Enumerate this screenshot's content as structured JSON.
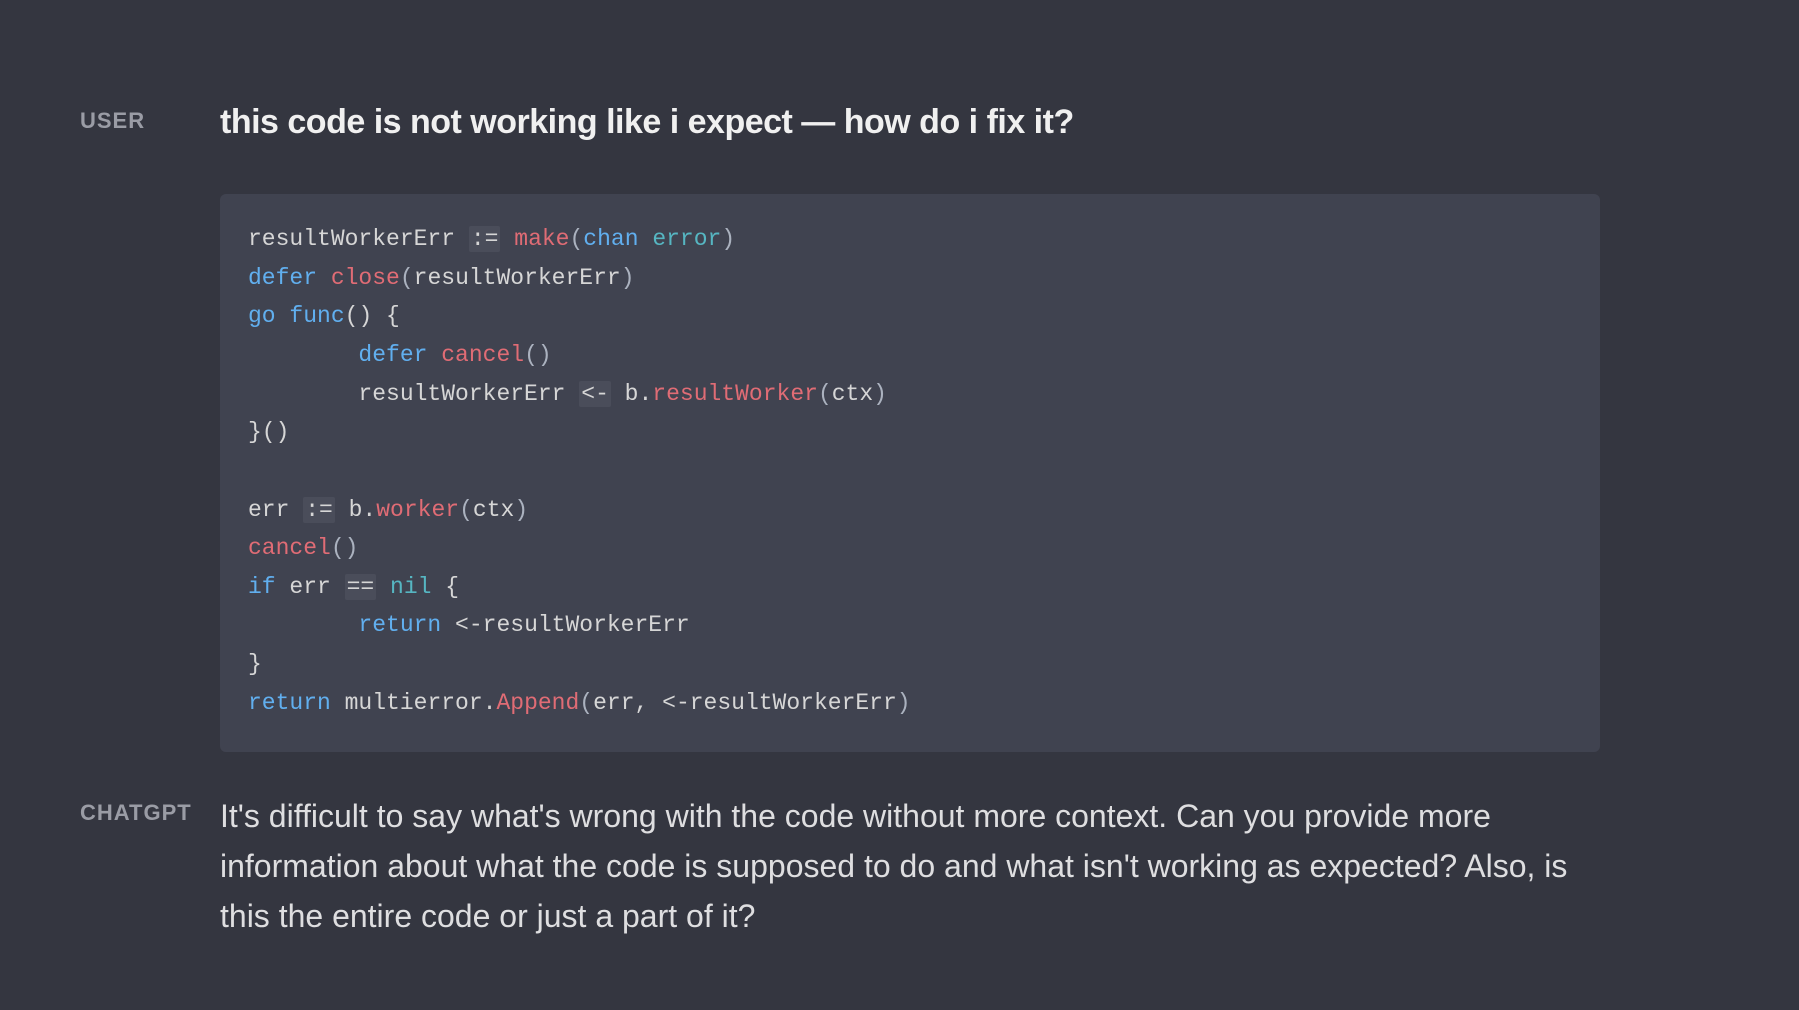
{
  "roles": {
    "user": "USER",
    "assistant": "CHATGPT"
  },
  "user": {
    "question": "this code is not working like i expect — how do i fix it?",
    "code": {
      "l1": {
        "a": "resultWorkerErr ",
        "op": ":=",
        "make": "make",
        "p1": "(",
        "chan": "chan",
        "sp": " ",
        "error": "error",
        "p2": ")"
      },
      "l2": {
        "defer": "defer",
        "sp": " ",
        "close": "close",
        "p1": "(",
        "arg": "resultWorkerErr",
        "p2": ")"
      },
      "l3": {
        "go": "go",
        "sp": " ",
        "func": "func",
        "rest": "() {"
      },
      "l4": {
        "indent": "        ",
        "defer": "defer",
        "sp": " ",
        "cancel": "cancel",
        "paren": "()"
      },
      "l5": {
        "indent": "        ",
        "a": "resultWorkerErr ",
        "op": "<-",
        "b": " b.",
        "rw": "resultWorker",
        "p1": "(",
        "arg": "ctx",
        "p2": ")"
      },
      "l6": {
        "text": "}()"
      },
      "l7": {
        "text": ""
      },
      "l8": {
        "a": "err ",
        "op": ":=",
        "b": " b.",
        "worker": "worker",
        "p1": "(",
        "arg": "ctx",
        "p2": ")"
      },
      "l9": {
        "cancel": "cancel",
        "paren": "()"
      },
      "l10": {
        "if": "if",
        "a": " err ",
        "op": "==",
        "sp": " ",
        "nil": "nil",
        "rest": " {"
      },
      "l11": {
        "indent": "        ",
        "return": "return",
        "a": " <-resultWorkerErr"
      },
      "l12": {
        "text": "}"
      },
      "l13": {
        "return": "return",
        "a": " multierror.",
        "append": "Append",
        "p1": "(",
        "arg1": "err",
        "c": ", ",
        "arg2": "<-resultWorkerErr",
        "p2": ")"
      }
    }
  },
  "assistant": {
    "reply": "It's difficult to say what's wrong with the code without more context. Can you provide more information about what the code is supposed to do and what isn't working as expected? Also, is this the entire code or just a part of it?"
  }
}
